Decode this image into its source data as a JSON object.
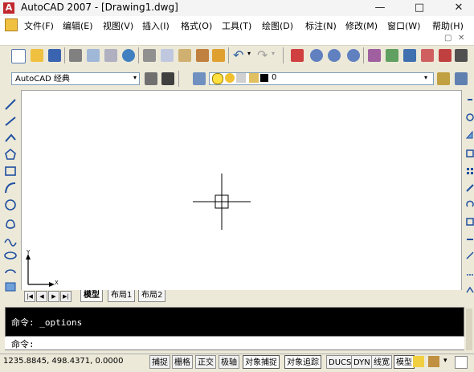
{
  "window": {
    "app_icon": "A",
    "title": "AutoCAD 2007 - [Drawing1.dwg]",
    "minimize": "—",
    "maximize": "□",
    "close": "✕"
  },
  "menubar": {
    "doc_icon": "doc-icon",
    "items": [
      "文件(F)",
      "编辑(E)",
      "视图(V)",
      "插入(I)",
      "格式(O)",
      "工具(T)",
      "绘图(D)",
      "标注(N)",
      "修改(M)",
      "窗口(W)",
      "帮助(H)"
    ],
    "doc_restore": "▢",
    "doc_close": "✕"
  },
  "toolbar2": {
    "workspace": "AutoCAD 经典",
    "layer_value": "0"
  },
  "tabs": {
    "nav": [
      "|◀",
      "◀",
      "▶",
      "▶|"
    ],
    "items": [
      "模型",
      "布局1",
      "布局2"
    ]
  },
  "ucs": {
    "x_label": "X",
    "y_label": "Y"
  },
  "command": {
    "line1": "命令: _options",
    "prompt": "命令:"
  },
  "status": {
    "coords": "1235.8845, 498.4371, 0.0000",
    "buttons": [
      "捕捉",
      "栅格",
      "正交",
      "极轴",
      "对象捕捉",
      "对象追踪",
      "DUCS",
      "DYN",
      "线宽",
      "模型"
    ]
  },
  "colors": {
    "accent": "#c0282d",
    "canvas": "#ffffff",
    "command_bg": "#000000"
  }
}
